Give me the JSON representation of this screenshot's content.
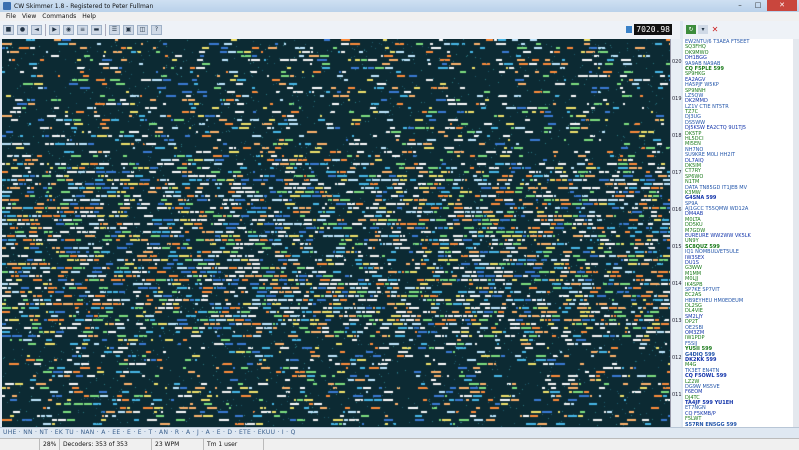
{
  "window": {
    "title": "CW Skimmer 1.8  -  Registered to Peter Fullman",
    "minimize": "–",
    "maximize": "□",
    "close": "✕"
  },
  "menu": [
    "File",
    "View",
    "Commands",
    "Help"
  ],
  "toolbar": {
    "buttons": [
      "connect-icon",
      "record-icon",
      "speaker-icon",
      "play-icon",
      "dial-icon",
      "filter-icon",
      "marker-icon",
      "settings-icon",
      "chat-icon",
      "map-icon",
      "help-icon"
    ],
    "frequency": "7020.98"
  },
  "spots_toolbar": {
    "icons": [
      "refresh-icon",
      "filter-icon",
      "delete-icon"
    ]
  },
  "scale_labels": [
    "020",
    "019",
    "018",
    "017",
    "016",
    "015",
    "014",
    "013",
    "012",
    "011"
  ],
  "spots": [
    {
      "text": "EW2NTU/6 T3AEA FT5EET",
      "color": "#2255aa"
    },
    {
      "text": "SQ3FHQ",
      "color": "#1a7a1a"
    },
    {
      "text": "DK9MWO",
      "color": "#1a7a1a"
    },
    {
      "text": "DH1BGG",
      "color": "#1133aa"
    },
    {
      "text": "9A9AB NA9AB",
      "color": "#2255aa"
    },
    {
      "text": "CQ F5PLE 599",
      "color": "#1a7a1a"
    },
    {
      "text": "SP9HKG",
      "color": "#1a7a1a"
    },
    {
      "text": "EA2AGV",
      "color": "#1133aa"
    },
    {
      "text": "HA5PJF W5KP",
      "color": "#2255aa"
    },
    {
      "text": "SP9NNH",
      "color": "#1a7a1a"
    },
    {
      "text": "LZ5QW",
      "color": "#2255aa"
    },
    {
      "text": "DK2MMD",
      "color": "#1133aa"
    },
    {
      "text": "LZ1V CTIE NT5TR",
      "color": "#2255aa"
    },
    {
      "text": "TZ7C",
      "color": "#1a7a1a"
    },
    {
      "text": "DJ3UG",
      "color": "#2255aa"
    },
    {
      "text": "DS5WW",
      "color": "#2255aa"
    },
    {
      "text": "DJ5KSW EA2CTQ 9U1TJ5",
      "color": "#1133aa"
    },
    {
      "text": "DK5TP",
      "color": "#1a7a1a"
    },
    {
      "text": "HL5DCI",
      "color": "#1a7a1a"
    },
    {
      "text": "MI5EN",
      "color": "#1a7a1a"
    },
    {
      "text": "NH7NO",
      "color": "#2255aa"
    },
    {
      "text": "SU9KRE M0LI HH2IT",
      "color": "#2255aa"
    },
    {
      "text": "DL7AIQ",
      "color": "#1133aa"
    },
    {
      "text": "DK5IM",
      "color": "#1a7a1a"
    },
    {
      "text": "CT7RY",
      "color": "#1a7a1a"
    },
    {
      "text": "SP6WO",
      "color": "#1a7a1a"
    },
    {
      "text": "N1TM",
      "color": "#1a7a1a"
    },
    {
      "text": "DATA TN85GD IT1JEB MV",
      "color": "#2255aa"
    },
    {
      "text": "K3MW",
      "color": "#1a7a1a"
    },
    {
      "text": "G4SNA 599",
      "color": "#1133aa"
    },
    {
      "text": "SP9A",
      "color": "#2255aa"
    },
    {
      "text": "AJ1GCC T55QMW WD12A",
      "color": "#2255aa"
    },
    {
      "text": "DM4AB",
      "color": "#1133aa"
    },
    {
      "text": "M0LTA",
      "color": "#1a7a1a"
    },
    {
      "text": "DD5KU",
      "color": "#1a7a1a"
    },
    {
      "text": "M7GDW",
      "color": "#1a7a1a"
    },
    {
      "text": "EUREURE WW2WW VK5LK",
      "color": "#1133aa"
    },
    {
      "text": "UN9Y",
      "color": "#1a7a1a"
    },
    {
      "text": "SC8QUZ 599",
      "color": "#1a7a1a"
    },
    {
      "text": "IQ1 NOMBULVET5ULE",
      "color": "#2255aa"
    },
    {
      "text": "IW3SEX",
      "color": "#1133aa"
    },
    {
      "text": "DU1S",
      "color": "#1133aa"
    },
    {
      "text": "G3WW",
      "color": "#1a7a1a"
    },
    {
      "text": "M1MM",
      "color": "#1a7a1a"
    },
    {
      "text": "M0LJJ",
      "color": "#1a7a1a"
    },
    {
      "text": "IK4SPB",
      "color": "#1a7a1a"
    },
    {
      "text": "SP7KE SP7VIT",
      "color": "#2255aa"
    },
    {
      "text": "EC2AS",
      "color": "#1a7a1a"
    },
    {
      "text": "HB9EYHEU HM0EDEUM",
      "color": "#2255aa"
    },
    {
      "text": "DL2SG",
      "color": "#1a7a1a"
    },
    {
      "text": "DL4VIE",
      "color": "#1a7a1a"
    },
    {
      "text": "SM2LJY",
      "color": "#1133aa"
    },
    {
      "text": "DP2T",
      "color": "#1a7a1a"
    },
    {
      "text": "OE2SBI",
      "color": "#2255aa"
    },
    {
      "text": "OM3ZM",
      "color": "#1133aa"
    },
    {
      "text": "IW1PDP",
      "color": "#1a7a1a"
    },
    {
      "text": "F5SIJ",
      "color": "#2255aa"
    },
    {
      "text": "YU5II 599",
      "color": "#1a7a1a"
    },
    {
      "text": "G4DIQ 599",
      "color": "#2255aa"
    },
    {
      "text": "DK2KK 599",
      "color": "#1133aa"
    },
    {
      "text": "M4G",
      "color": "#1a7a1a"
    },
    {
      "text": "TK3ET EN4TN",
      "color": "#2255aa"
    },
    {
      "text": "CQ F5OWL 599",
      "color": "#1133aa"
    },
    {
      "text": "LZ2W",
      "color": "#1a7a1a"
    },
    {
      "text": "DG9W MS5VE",
      "color": "#2255aa"
    },
    {
      "text": "F6EOM",
      "color": "#1133aa"
    },
    {
      "text": "DJ4TC",
      "color": "#1a7a1a"
    },
    {
      "text": "TA4JF 599 YU1EH",
      "color": "#1133aa"
    },
    {
      "text": "ET7NGN",
      "color": "#2255aa"
    },
    {
      "text": "CQ F5KMB/P",
      "color": "#1133aa"
    },
    {
      "text": "F5LWT",
      "color": "#1a7a1a"
    },
    {
      "text": "S57RN EN5GG 599",
      "color": "#2255aa"
    }
  ],
  "ticker": "UHE  ·  NN  ·  NT  ·  EK  TU  ·  NAN  ·  A  ·  EE  ·  E  ·  E  ·  T  ·  AN  ·  R  ·  A  ·  J  ·  A  ·  E  ·  D  ·  ETE  ·  EKUU  ·  I  ·  Q",
  "status": {
    "level": "28%",
    "decoders": "Decoders: 353 of 353",
    "wpm": "23 WPM",
    "user": "Tm 1 user"
  }
}
